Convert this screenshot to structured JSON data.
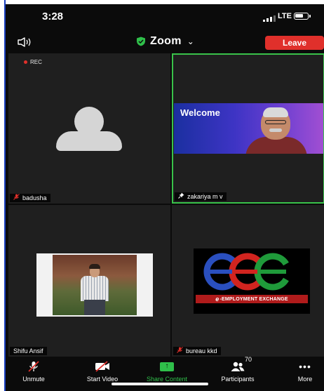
{
  "status_bar": {
    "time": "3:28",
    "network": "LTE"
  },
  "header": {
    "title": "Zoom",
    "leave_label": "Leave"
  },
  "tiles": [
    {
      "name": "badusha",
      "recording_label": "REC",
      "muted": true
    },
    {
      "name": "zakariya m v",
      "video_text": "Welcome",
      "pinned": true,
      "active_speaker": true
    },
    {
      "name": "Shifu Ansif",
      "muted": false
    },
    {
      "name": "bureau kkd",
      "muted": true,
      "logo_text_prefix": "e",
      "logo_text": "-EMPLOYMENT EXCHANGE"
    }
  ],
  "toolbar": {
    "unmute_label": "Unmute",
    "start_video_label": "Start Video",
    "share_label": "Share Content",
    "participants_label": "Participants",
    "participants_count": "70",
    "more_label": "More"
  },
  "colors": {
    "accent_green": "#2fbf4a",
    "leave_red": "#e0302b",
    "speaker_border": "#39c24a"
  },
  "icons": [
    "speaker-icon",
    "shield-check-icon",
    "chevron-down-icon",
    "mic-muted-icon",
    "video-off-icon",
    "share-screen-icon",
    "participants-icon",
    "more-icon",
    "pin-icon",
    "battery-icon",
    "signal-icon"
  ]
}
